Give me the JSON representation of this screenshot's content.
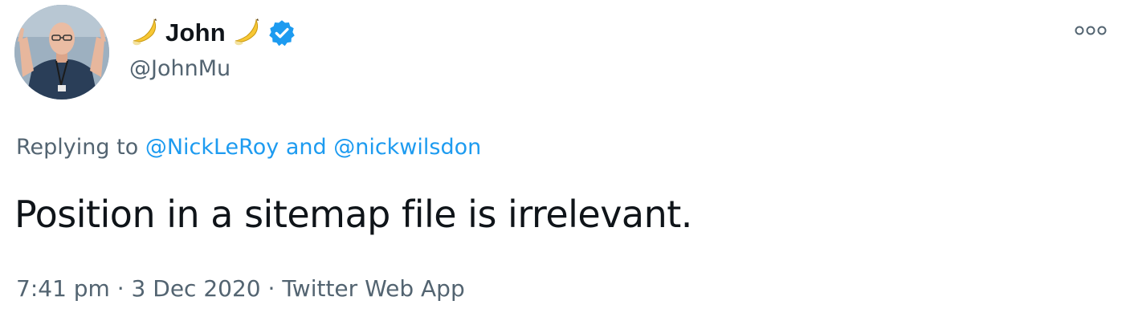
{
  "author": {
    "name": "John",
    "name_emoji": "banana-icon",
    "handle": "@JohnMu",
    "verified": true,
    "verified_color": "#1d9bf0"
  },
  "reply": {
    "prefix": "Replying to",
    "mention_1": "@NickLeRoy",
    "joiner": "and",
    "mention_2": "@nickwilsdon"
  },
  "tweet": {
    "text": "Position in a sitemap file is irrelevant."
  },
  "meta": {
    "time": "7:41 pm",
    "separator": "·",
    "date": "3 Dec 2020",
    "source": "Twitter Web App"
  },
  "colors": {
    "text_primary": "#0f1419",
    "text_secondary": "#536471",
    "link": "#1d9bf0"
  },
  "menu_icon": "more-dots-icon"
}
